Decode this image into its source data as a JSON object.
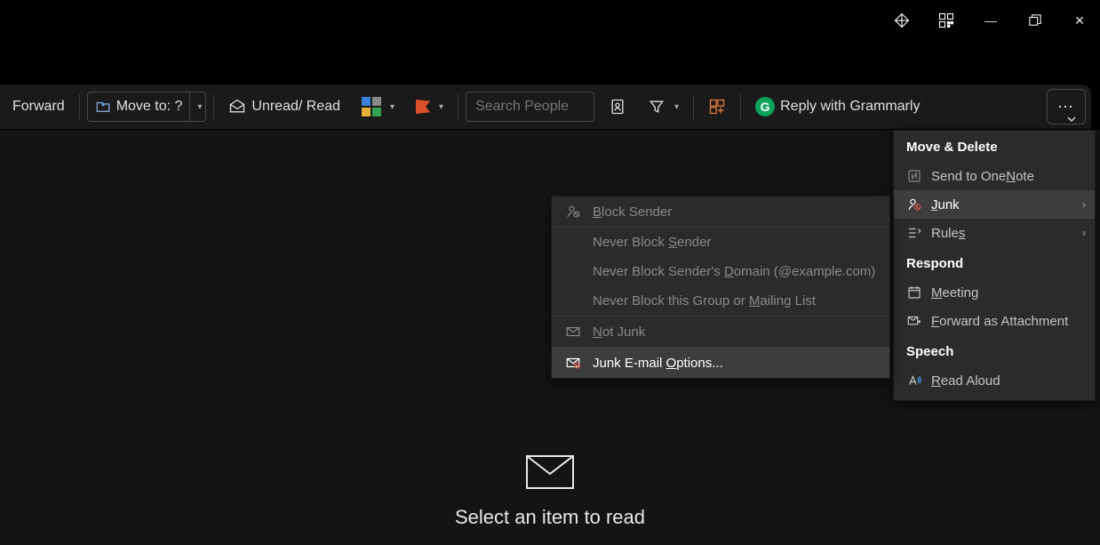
{
  "window_controls": {
    "premium": "◈",
    "qr": "▦",
    "minimize": "—",
    "maximize": "▢",
    "close": "✕"
  },
  "ribbon": {
    "forward": "Forward",
    "move_to": "Move to: ?",
    "unread_read": "Unread/ Read",
    "search_placeholder": "Search People",
    "grammarly": "Reply with Grammarly"
  },
  "overflow": {
    "heading1": "Move & Delete",
    "send_onenote": "Send to OneNote",
    "send_onenote_ukey": "N",
    "junk": "Junk",
    "junk_ukey": "J",
    "rules": "Rules",
    "rules_ukey": "s",
    "heading2": "Respond",
    "meeting": "Meeting",
    "meeting_ukey": "M",
    "fwd_attach": "Forward as Attachment",
    "fwd_attach_ukey": "F",
    "heading3": "Speech",
    "read_aloud": "Read Aloud",
    "read_aloud_ukey": "R"
  },
  "junk_menu": {
    "block_sender": "Block Sender",
    "block_sender_u": "B",
    "never_block_sender": "Never Block Sender",
    "never_block_sender_u": "S",
    "never_block_domain": "Never Block Sender's Domain (@example.com)",
    "never_block_domain_u": "D",
    "never_block_group": "Never Block this Group or Mailing List",
    "never_block_group_u": "M",
    "not_junk": "Not Junk",
    "not_junk_u": "N",
    "junk_options": "Junk E-mail Options...",
    "junk_options_u": "O"
  },
  "reading_pane": {
    "empty_text": "Select an item to read"
  }
}
